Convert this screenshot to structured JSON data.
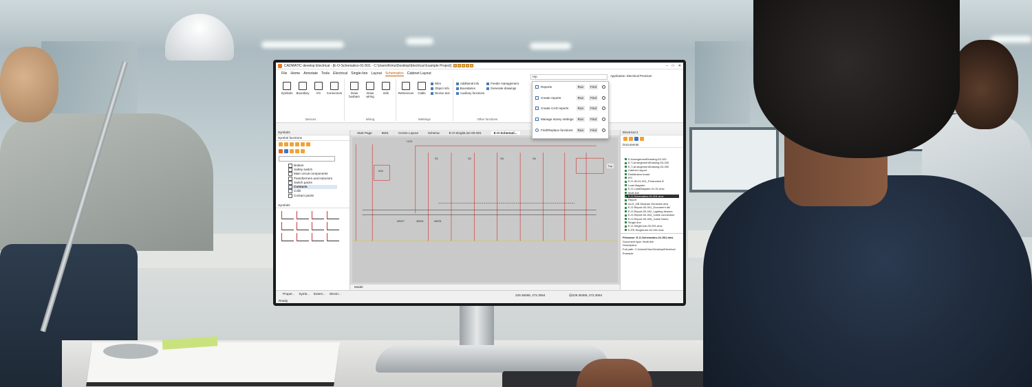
{
  "app": {
    "title": "CADMATIC develop Electrical - [E-O-Schematics-01-501 - C:\\Users\\Kimu\\Desktop\\Electrical Example Project]",
    "search_value": "rep",
    "application_label": "Application:",
    "application_value": "Electrical Premium"
  },
  "menu": [
    "File",
    "Home",
    "Annotate",
    "Tools",
    "Electrical",
    "Single-line",
    "Layout",
    "Schematics",
    "Cabinet Layout"
  ],
  "menu_active": "Schematics",
  "ribbon": {
    "devices": {
      "buttons": [
        "Symbols",
        "Boundary",
        "I/O",
        "Connectors"
      ],
      "label": "Devices"
    },
    "wiring": {
      "buttons": [
        "Draw busbars",
        "Draw wiring",
        "Edit"
      ],
      "label": "Wiring"
    },
    "markings": {
      "buttons": [
        "References",
        "Cable"
      ],
      "small": [
        "Wire",
        "Object info",
        "Device text"
      ],
      "label": "Markings"
    },
    "other": {
      "small": [
        "Additional info",
        "Boundaries",
        "Auxiliary functions",
        "Feeder management",
        "Generate drawings"
      ],
      "label": "Other functions"
    }
  },
  "search_results": [
    {
      "label": "Reports",
      "run": "Run",
      "find": "Find"
    },
    {
      "label": "Create reports",
      "run": "Run",
      "find": "Find"
    },
    {
      "label": "Create CAD reports",
      "run": "Run",
      "find": "Find"
    },
    {
      "label": "Manage storey settings",
      "run": "Run",
      "find": "Find"
    },
    {
      "label": "Find/Replace functions",
      "run": "Run",
      "find": "Find"
    }
  ],
  "left_panel": {
    "title": "Symbols",
    "section": "Symbol functions",
    "tree": [
      "Brakes",
      "Safety switch",
      "Main circuit components",
      "Transformers and inductors",
      "Switch packs",
      "Contacts",
      "Coils",
      "Contact packs"
    ],
    "tree_selected": "Contacts",
    "symbols_section": "Symbols"
  },
  "doc_tabs": [
    "Start Page",
    "5501",
    "Centre Layout",
    "Schema",
    "E-O-SingleLine-00-001",
    "E-O-Schemati..."
  ],
  "doc_tab_active": "E-O-Schemati...",
  "canvas_labels": {
    "top": "Top",
    "refs": [
      "+123",
      "-W027",
      "-W001",
      "-W031"
    ],
    "devices": [
      "S1",
      "S2",
      "S3",
      "S4",
      "K01"
    ]
  },
  "right_panel": {
    "title": "Electrical 2",
    "documents_label": "Documents",
    "tree": [
      "E-ArrangementDrawing-03-100",
      "E-T-ArrangementDrawing-03-200",
      "E-T-ArrangementDrawing-03-300",
      "Cabinet Layout",
      "Distribution board",
      "IFC",
      "E-O-30-01-001_Production B",
      "Load diagram",
      "E-O-LoadDiagram-01-01.dnw",
      "Multi-line",
      "E-O-Schematics-01-501.dnw",
      "Report",
      "ALIX_DB Modular Generate.dnw",
      "E-O-Report-00-001_Document list",
      "E-O-Report-00-002_Lighting fixtures",
      "E-O-Report-00-004_Cable connection",
      "E-O-Report-00-005_Cable Notes",
      "Single-line",
      "E-O-SingleLine-00-001.dnw",
      "E-PE-SingleLine-02-001.dnw"
    ],
    "tree_selected": "E-O-Schematics-01-501.dnw",
    "file_info": [
      "Filename: E-O-Schematics-01-501.dnw",
      "Document type: Multi-line",
      "Description:",
      "Full path: C:\\Users\\Kimu\\Desktop\\Electrical Example"
    ]
  },
  "bottom_tabs": [
    "Proper...",
    "Symb...",
    "Extern...",
    "Electri..."
  ],
  "model_tab": "Model",
  "status": "Ready",
  "coord_1": "229.36368, 272.3064",
  "coord_2": "@229.36368, 272.3064"
}
